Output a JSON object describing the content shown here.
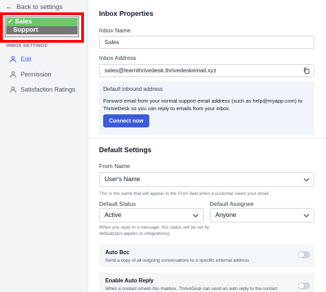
{
  "sidebar": {
    "back_label": "Back to settings",
    "inbox_selector": {
      "options": [
        "Sales",
        "Support"
      ],
      "selected": "Sales"
    },
    "section_label": "INBOX SETTINGS",
    "items": [
      {
        "label": "Edit",
        "icon": "user-icon",
        "active": true
      },
      {
        "label": "Permission",
        "icon": "user-icon",
        "active": false
      },
      {
        "label": "Satisfaction Ratings",
        "icon": "user-icon",
        "active": false
      }
    ]
  },
  "inbox_properties": {
    "title": "Inbox Properties",
    "name_label": "Inbox Name",
    "name_value": "Sales",
    "address_label": "Inbox Address",
    "address_value": "sales@learnthrivedesk.thrivedeskemail.xyz",
    "inbound": {
      "title": "Default inbound address",
      "text": "Forward email from your normal support email address (such as help@myapp.com) to ThriveDesk so you can reply to emails from your inbox.",
      "button_label": "Connect now"
    }
  },
  "default_settings": {
    "title": "Default Settings",
    "from_name_label": "From Name",
    "from_name_value": "User's Name",
    "from_name_hint": "This is the name that will appear in the From field when a customer views your email",
    "status_label": "Default Status",
    "status_value": "Active",
    "status_hint_1": "When you reply to a message, this status will be set by",
    "status_hint_2": "default(also applies to integrations).",
    "assignee_label": "Default Assignee",
    "assignee_value": "Anyone",
    "auto_bcc": {
      "title": "Auto Bcc",
      "desc": "Send a copy of all outgoing conversations to a specific external address",
      "enabled": false
    },
    "auto_reply": {
      "title": "Enable Auto Reply",
      "desc": "When a contact emails this mailbox, ThriveDesk can send an auto reply to the contact",
      "enabled": false
    }
  },
  "colors": {
    "accent": "#3b5bdb",
    "highlight_border": "#ff0000",
    "selected_option": "#6cc868"
  }
}
